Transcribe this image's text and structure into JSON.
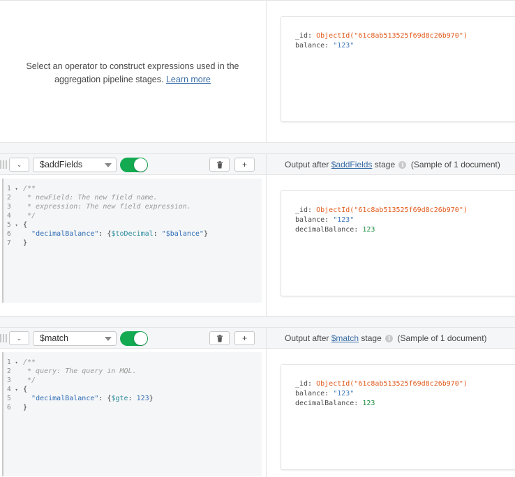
{
  "top": {
    "hint_text": "Select an operator to construct expressions used in the aggregation pipeline stages.",
    "hint_link": "Learn more",
    "doc": {
      "id_key": "_id:",
      "id_value": "ObjectId(\"61c8ab513525f69d8c26b970\")",
      "balance_key": "balance:",
      "balance_value": "\"123\""
    }
  },
  "stages": [
    {
      "operator": "$addFields",
      "enabled": true,
      "delete_icon": "trash-icon",
      "add_label": "+",
      "collapse_icon": "chevron-down-icon",
      "output_prefix": "Output after",
      "output_link": "$addFields",
      "output_suffix": "stage",
      "sample_text": "(Sample of 1 document)",
      "code": [
        {
          "n": "1",
          "fold": "▾",
          "text": "/**",
          "cls": "cm"
        },
        {
          "n": "2",
          "fold": "",
          "text": " * newField: The new field name.",
          "cls": "cm"
        },
        {
          "n": "3",
          "fold": "",
          "text": " * expression: The new field expression.",
          "cls": "cm"
        },
        {
          "n": "4",
          "fold": "",
          "text": " */",
          "cls": "cm"
        },
        {
          "n": "5",
          "fold": "▾",
          "text": "{",
          "cls": "brace"
        },
        {
          "n": "6",
          "fold": "",
          "text": "",
          "cls": "kv"
        },
        {
          "n": "7",
          "fold": "",
          "text": "}",
          "cls": "brace"
        }
      ],
      "code_kv": {
        "key": "\"decimalBalance\"",
        "colon": ": ",
        "open": "{",
        "op": "$toDecimal",
        "sep": ": ",
        "val": "\"$balance\"",
        "close": "}"
      },
      "doc": {
        "id_key": "_id:",
        "id_value": "ObjectId(\"61c8ab513525f69d8c26b970\")",
        "balance_key": "balance:",
        "balance_value": "\"123\"",
        "dec_key": "decimalBalance:",
        "dec_value": "123"
      }
    },
    {
      "operator": "$match",
      "enabled": true,
      "delete_icon": "trash-icon",
      "add_label": "+",
      "collapse_icon": "chevron-down-icon",
      "output_prefix": "Output after",
      "output_link": "$match",
      "output_suffix": "stage",
      "sample_text": "(Sample of 1 document)",
      "code": [
        {
          "n": "1",
          "fold": "▾",
          "text": "/**",
          "cls": "cm"
        },
        {
          "n": "2",
          "fold": "",
          "text": " * query: The query in MQL.",
          "cls": "cm"
        },
        {
          "n": "3",
          "fold": "",
          "text": " */",
          "cls": "cm"
        },
        {
          "n": "4",
          "fold": "▾",
          "text": "{",
          "cls": "brace"
        },
        {
          "n": "5",
          "fold": "",
          "text": "",
          "cls": "kv"
        },
        {
          "n": "6",
          "fold": "",
          "text": "}",
          "cls": "brace"
        }
      ],
      "code_kv": {
        "key": "\"decimalBalance\"",
        "colon": ": ",
        "open": "{",
        "op": "$gte",
        "sep": ": ",
        "val": "123",
        "close": "}"
      },
      "doc": {
        "id_key": "_id:",
        "id_value": "ObjectId(\"61c8ab513525f69d8c26b970\")",
        "balance_key": "balance:",
        "balance_value": "\"123\"",
        "dec_key": "decimalBalance:",
        "dec_value": "123"
      }
    }
  ]
}
